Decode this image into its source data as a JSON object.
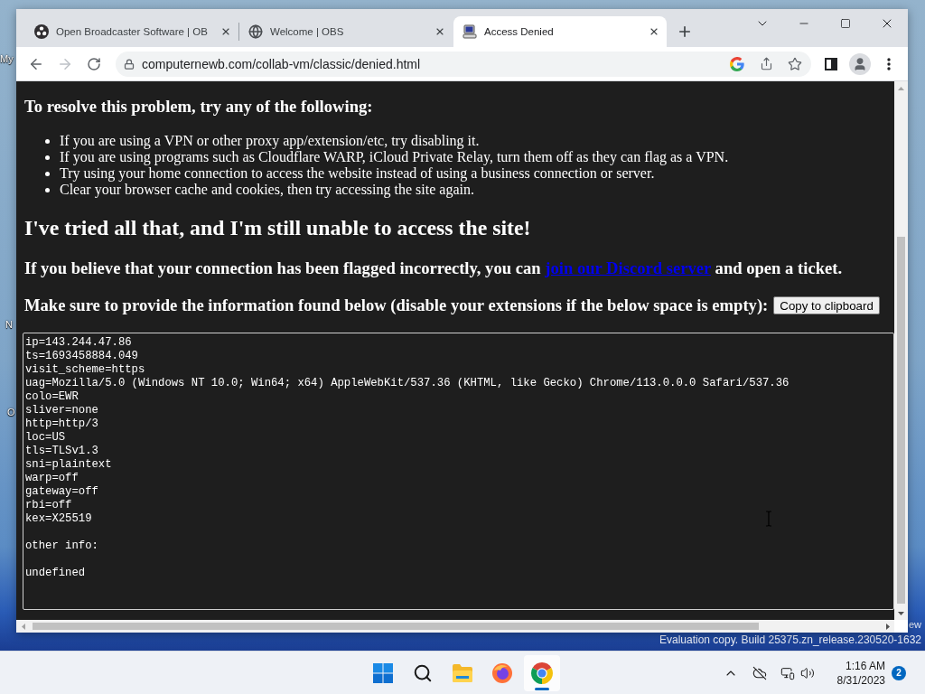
{
  "desktop": {
    "icon_labels": [
      "My",
      "N",
      "O"
    ],
    "edition_text": "ew",
    "build_notice": "Evaluation copy. Build 25375.zn_release.230520-1632"
  },
  "browser": {
    "tabs": [
      {
        "title": "Open Broadcaster Software | OB",
        "selected": false
      },
      {
        "title": "Welcome | OBS",
        "selected": false
      },
      {
        "title": "Access Denied",
        "selected": true
      }
    ],
    "address_bar": {
      "url": "computernewb.com/collab-vm/classic/denied.html"
    }
  },
  "page": {
    "heading": "To resolve this problem, try any of the following:",
    "tips": [
      "If you are using a VPN or other proxy app/extension/etc, try disabling it.",
      "If you are using programs such as Cloudflare WARP, iCloud Private Relay, turn them off as they can flag as a VPN.",
      "Try using your home connection to access the website instead of using a business connection or server.",
      "Clear your browser cache and cookies, then try accessing the site again."
    ],
    "title": "I've tried all that, and I'm still unable to access the site!",
    "discord_note": {
      "before": "If you believe that your connection has been flagged incorrectly, you can",
      "link": "join our Discord server",
      "after": "and open a ticket."
    },
    "info_prompt": "Make sure to provide the information found below (disable your extensions if the below space is empty):",
    "copy_button": "Copy to clipboard",
    "info_box": {
      "fields": [
        "ip=143.244.47.86",
        "ts=1693458884.049",
        "visit_scheme=https",
        "uag=Mozilla/5.0 (Windows NT 10.0; Win64; x64) AppleWebKit/537.36 (KHTML, like Gecko) Chrome/113.0.0.0 Safari/537.36",
        "colo=EWR",
        "sliver=none",
        "http=http/3",
        "loc=US",
        "tls=TLSv1.3",
        "sni=plaintext",
        "warp=off",
        "gateway=off",
        "rbi=off",
        "kex=X25519"
      ],
      "other_info_label": "other info:",
      "other_info_value": "undefined"
    }
  },
  "taskbar": {
    "apps": [
      {
        "selected": false
      },
      {
        "selected": false
      },
      {
        "selected": true
      }
    ],
    "clock": {
      "time": "1:16 AM",
      "date": "8/31/2023"
    },
    "notification_count": "2"
  }
}
